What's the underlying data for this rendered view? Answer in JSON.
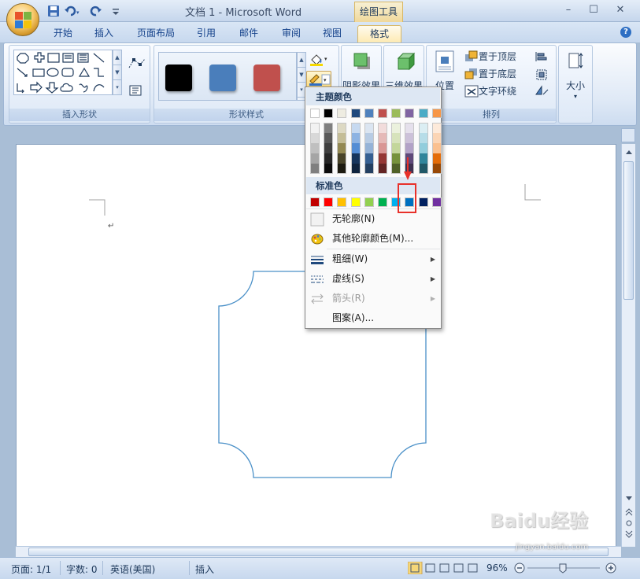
{
  "window": {
    "title": "文档 1 - Microsoft Word",
    "context_tool": "绘图工具",
    "controls": [
      "–",
      "☐",
      "✕"
    ]
  },
  "tabs": [
    {
      "label": "开始",
      "active": false
    },
    {
      "label": "插入",
      "active": false
    },
    {
      "label": "页面布局",
      "active": false
    },
    {
      "label": "引用",
      "active": false
    },
    {
      "label": "邮件",
      "active": false
    },
    {
      "label": "审阅",
      "active": false
    },
    {
      "label": "视图",
      "active": false
    },
    {
      "label": "格式",
      "active": true
    }
  ],
  "help_label": "?",
  "ribbon": {
    "insert_shapes_label": "插入形状",
    "shape_styles_label": "形状样式",
    "arrange_label": "排列",
    "style_swatches": [
      "#000000",
      "#4a7ebb",
      "#c0504d"
    ],
    "shadow_effects_label": "阴影效果",
    "threed_effects_label": "三维效果",
    "position_label": "位置",
    "bring_front_label": "置于顶层",
    "send_back_label": "置于底层",
    "text_wrap_label": "文字环绕",
    "size_label": "大小"
  },
  "outline_menu": {
    "theme_colors_header": "主题颜色",
    "standard_colors_header": "标准色",
    "theme_top_row": [
      "#ffffff",
      "#000000",
      "#eeece1",
      "#1f497d",
      "#4f81bd",
      "#c0504d",
      "#9bbb59",
      "#8064a2",
      "#4bacc6",
      "#f79646"
    ],
    "theme_columns": [
      [
        "#f2f2f2",
        "#d8d8d8",
        "#bfbfbf",
        "#a5a5a5",
        "#7f7f7f"
      ],
      [
        "#7f7f7f",
        "#595959",
        "#3f3f3f",
        "#262626",
        "#0c0c0c"
      ],
      [
        "#ddd9c3",
        "#c4bd97",
        "#938953",
        "#494429",
        "#1d1b10"
      ],
      [
        "#c6d9f0",
        "#8db3e2",
        "#548dd4",
        "#17365d",
        "#0f243e"
      ],
      [
        "#dbe5f1",
        "#b8cce4",
        "#95b3d7",
        "#366092",
        "#244061"
      ],
      [
        "#f2dcdb",
        "#e5b9b7",
        "#d99694",
        "#953734",
        "#632423"
      ],
      [
        "#ebf1dd",
        "#d7e3bc",
        "#c3d69b",
        "#76923c",
        "#4f6128"
      ],
      [
        "#e5e0ec",
        "#ccc1d9",
        "#b2a2c7",
        "#5f497a",
        "#3f3151"
      ],
      [
        "#dbeef3",
        "#b7dde8",
        "#92cddc",
        "#31859b",
        "#205867"
      ],
      [
        "#fdeada",
        "#fbd5b5",
        "#fac08f",
        "#e36c09",
        "#974806"
      ]
    ],
    "standard_row": [
      "#c00000",
      "#ff0000",
      "#ffc000",
      "#ffff00",
      "#92d050",
      "#00b050",
      "#00b0f0",
      "#0070c0",
      "#002060",
      "#7030a0"
    ],
    "items": [
      {
        "label": "无轮廓(N)",
        "has_submenu": false,
        "disabled": false,
        "icon": "no-outline-icon"
      },
      {
        "label": "其他轮廓颜色(M)...",
        "has_submenu": false,
        "disabled": false,
        "icon": "palette-icon"
      },
      {
        "label": "粗细(W)",
        "has_submenu": true,
        "disabled": false,
        "icon": "weight-lines-icon"
      },
      {
        "label": "虚线(S)",
        "has_submenu": true,
        "disabled": false,
        "icon": "dashes-icon"
      },
      {
        "label": "箭头(R)",
        "has_submenu": true,
        "disabled": true,
        "icon": "arrows-icon"
      },
      {
        "label": "图案(A)...",
        "has_submenu": false,
        "disabled": false,
        "icon": ""
      }
    ]
  },
  "document": {
    "shape_outline_color": "#4a90c8"
  },
  "statusbar": {
    "page": "页面: 1/1",
    "words": "字数: 0",
    "language": "英语(美国)",
    "insert_mode": "插入",
    "zoom": "96%"
  },
  "watermark": {
    "logo": "Baidu经验",
    "url": "jingyan.baidu.com"
  }
}
